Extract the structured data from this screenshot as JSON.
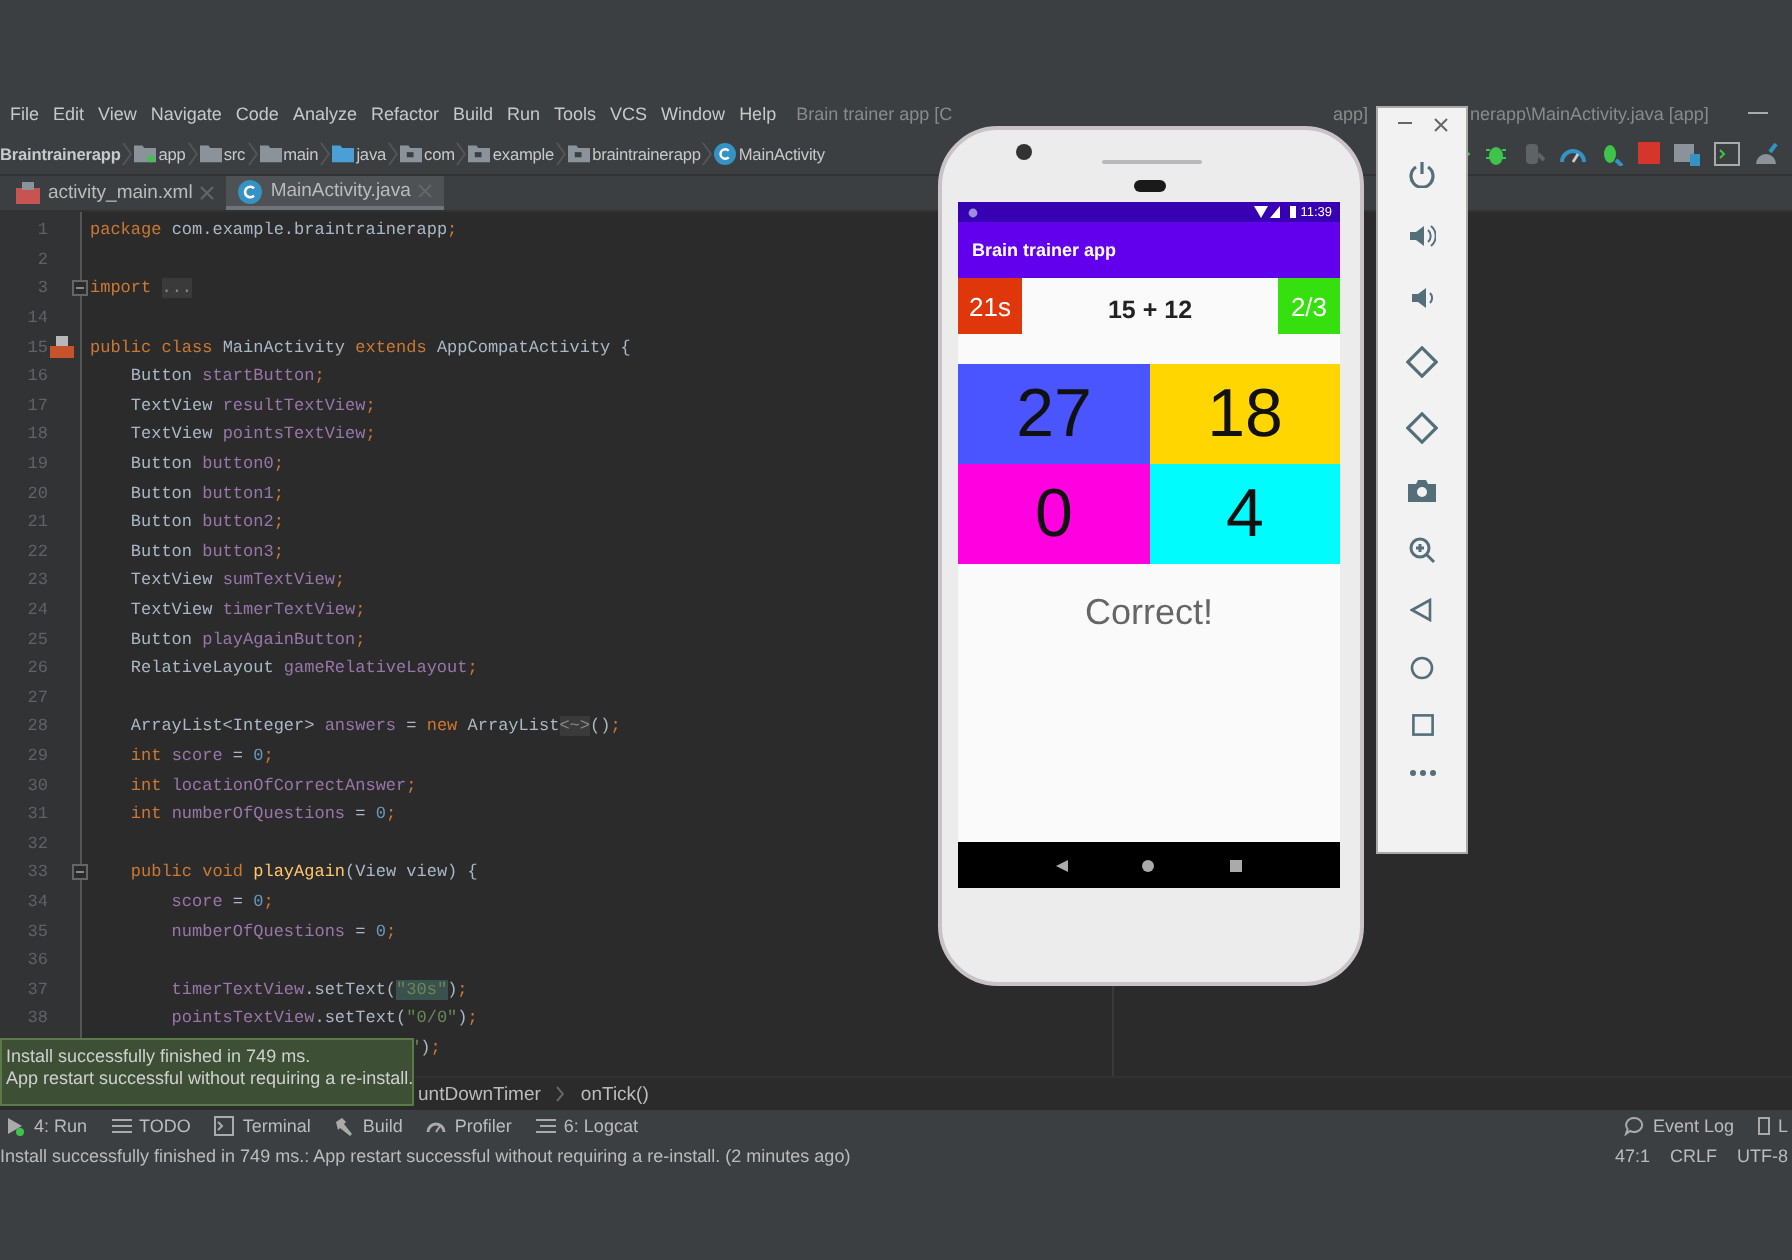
{
  "menu": {
    "items": [
      "File",
      "Edit",
      "View",
      "Navigate",
      "Code",
      "Analyze",
      "Refactor",
      "Build",
      "Run",
      "Tools",
      "VCS",
      "Window",
      "Help"
    ],
    "title_parts": [
      "Brain trainer app [C",
      "app]",
      "nerapp\\MainActivity.java [app]"
    ]
  },
  "breadcrumb": [
    {
      "label": "Braintrainerapp",
      "kind": "project"
    },
    {
      "label": "app",
      "kind": "module"
    },
    {
      "label": "src",
      "kind": "folder"
    },
    {
      "label": "main",
      "kind": "folder"
    },
    {
      "label": "java",
      "kind": "source"
    },
    {
      "label": "com",
      "kind": "package"
    },
    {
      "label": "example",
      "kind": "package"
    },
    {
      "label": "braintrainerapp",
      "kind": "package"
    },
    {
      "label": "MainActivity",
      "kind": "class"
    }
  ],
  "tabs": [
    {
      "label": "activity_main.xml",
      "kind": "layout",
      "selected": false
    },
    {
      "label": "MainActivity.java",
      "kind": "class",
      "selected": true
    }
  ],
  "editor": {
    "lines": [
      {
        "number": "1",
        "tokens": [
          {
            "kind": "k",
            "text": "package"
          },
          {
            "kind": "p",
            "text": " com.example.braintrainerapp"
          },
          {
            "kind": "k",
            "text": ";"
          }
        ]
      },
      {
        "number": "2"
      },
      {
        "number": "3",
        "kind": "fold",
        "tokens": [
          {
            "kind": "k",
            "text": "import "
          },
          {
            "kind": "g",
            "text": "..."
          }
        ]
      },
      {
        "number": "14"
      },
      {
        "number": "15",
        "kind": "class",
        "tokens": [
          {
            "kind": "k",
            "text": "public class "
          },
          {
            "kind": "p",
            "text": "MainActivity "
          },
          {
            "kind": "k",
            "text": "extends "
          },
          {
            "kind": "p",
            "text": "AppCompatActivity {"
          }
        ]
      },
      {
        "number": "16",
        "tokens": [
          {
            "kind": "p",
            "text": "    Button "
          },
          {
            "kind": "f",
            "text": "startButton"
          },
          {
            "kind": "k",
            "text": ";"
          }
        ]
      },
      {
        "number": "17",
        "tokens": [
          {
            "kind": "p",
            "text": "    TextView "
          },
          {
            "kind": "f",
            "text": "resultTextView"
          },
          {
            "kind": "k",
            "text": ";"
          }
        ]
      },
      {
        "number": "18",
        "tokens": [
          {
            "kind": "p",
            "text": "    TextView "
          },
          {
            "kind": "f",
            "text": "pointsTextView"
          },
          {
            "kind": "k",
            "text": ";"
          }
        ]
      },
      {
        "number": "19",
        "tokens": [
          {
            "kind": "p",
            "text": "    Button "
          },
          {
            "kind": "f",
            "text": "button0"
          },
          {
            "kind": "k",
            "text": ";"
          }
        ]
      },
      {
        "number": "20",
        "tokens": [
          {
            "kind": "p",
            "text": "    Button "
          },
          {
            "kind": "f",
            "text": "button1"
          },
          {
            "kind": "k",
            "text": ";"
          }
        ]
      },
      {
        "number": "21",
        "tokens": [
          {
            "kind": "p",
            "text": "    Button "
          },
          {
            "kind": "f",
            "text": "button2"
          },
          {
            "kind": "k",
            "text": ";"
          }
        ]
      },
      {
        "number": "22",
        "tokens": [
          {
            "kind": "p",
            "text": "    Button "
          },
          {
            "kind": "f",
            "text": "button3"
          },
          {
            "kind": "k",
            "text": ";"
          }
        ]
      },
      {
        "number": "23",
        "tokens": [
          {
            "kind": "p",
            "text": "    TextView "
          },
          {
            "kind": "f",
            "text": "sumTextView"
          },
          {
            "kind": "k",
            "text": ";"
          }
        ]
      },
      {
        "number": "24",
        "tokens": [
          {
            "kind": "p",
            "text": "    TextView "
          },
          {
            "kind": "f",
            "text": "timerTextView"
          },
          {
            "kind": "k",
            "text": ";"
          }
        ]
      },
      {
        "number": "25",
        "tokens": [
          {
            "kind": "p",
            "text": "    Button "
          },
          {
            "kind": "f",
            "text": "playAgainButton"
          },
          {
            "kind": "k",
            "text": ";"
          }
        ]
      },
      {
        "number": "26",
        "tokens": [
          {
            "kind": "p",
            "text": "    RelativeLayout "
          },
          {
            "kind": "f",
            "text": "gameRelativeLayout"
          },
          {
            "kind": "k",
            "text": ";"
          }
        ]
      },
      {
        "number": "27"
      },
      {
        "number": "28",
        "tokens": [
          {
            "kind": "p",
            "text": "    ArrayList<Integer> "
          },
          {
            "kind": "f",
            "text": "answers"
          },
          {
            "kind": "p",
            "text": " = "
          },
          {
            "kind": "k",
            "text": "new "
          },
          {
            "kind": "p",
            "text": "ArrayList"
          },
          {
            "kind": "g",
            "text": "<~>"
          },
          {
            "kind": "p",
            "text": "()"
          },
          {
            "kind": "k",
            "text": ";"
          }
        ]
      },
      {
        "number": "29",
        "tokens": [
          {
            "kind": "k",
            "text": "    int "
          },
          {
            "kind": "f",
            "text": "score"
          },
          {
            "kind": "p",
            "text": " = "
          },
          {
            "kind": "n",
            "text": "0"
          },
          {
            "kind": "k",
            "text": ";"
          }
        ]
      },
      {
        "number": "30",
        "tokens": [
          {
            "kind": "k",
            "text": "    int "
          },
          {
            "kind": "f",
            "text": "locationOfCorrectAnswer"
          },
          {
            "kind": "k",
            "text": ";"
          }
        ]
      },
      {
        "number": "31",
        "tokens": [
          {
            "kind": "k",
            "text": "    int "
          },
          {
            "kind": "f",
            "text": "numberOfQuestions"
          },
          {
            "kind": "p",
            "text": " = "
          },
          {
            "kind": "n",
            "text": "0"
          },
          {
            "kind": "k",
            "text": ";"
          }
        ]
      },
      {
        "number": "32"
      },
      {
        "number": "33",
        "kind": "fold",
        "tokens": [
          {
            "kind": "k",
            "text": "    public void "
          },
          {
            "kind": "m",
            "text": "playAgain"
          },
          {
            "kind": "p",
            "text": "(View view) {"
          }
        ]
      },
      {
        "number": "34",
        "tokens": [
          {
            "kind": "f",
            "text": "        score"
          },
          {
            "kind": "p",
            "text": " = "
          },
          {
            "kind": "n",
            "text": "0"
          },
          {
            "kind": "k",
            "text": ";"
          }
        ]
      },
      {
        "number": "35",
        "tokens": [
          {
            "kind": "f",
            "text": "        numberOfQuestions"
          },
          {
            "kind": "p",
            "text": " = "
          },
          {
            "kind": "n",
            "text": "0"
          },
          {
            "kind": "k",
            "text": ";"
          }
        ]
      },
      {
        "number": "36"
      },
      {
        "number": "37",
        "tokens": [
          {
            "kind": "f",
            "text": "        timerTextView"
          },
          {
            "kind": "p",
            "text": ".setText("
          },
          {
            "kind": "h",
            "text": "\"30s\""
          },
          {
            "kind": "p",
            "text": ")"
          },
          {
            "kind": "k",
            "text": ";"
          }
        ]
      },
      {
        "number": "38",
        "tokens": [
          {
            "kind": "f",
            "text": "        pointsTextView"
          },
          {
            "kind": "p",
            "text": ".setText("
          },
          {
            "kind": "s",
            "text": "\"0/0\""
          },
          {
            "kind": "p",
            "text": ")"
          },
          {
            "kind": "k",
            "text": ";"
          }
        ]
      },
      {
        "tokens": [
          {
            "kind": "s",
            "text": "\""
          },
          {
            "kind": "p",
            "text": ")"
          },
          {
            "kind": "k",
            "text": ";"
          }
        ]
      }
    ],
    "crumb": [
      "untDownTimer",
      "onTick()"
    ]
  },
  "notification": [
    "Install successfully finished in 749 ms.",
    "App restart successful without requiring a re-install."
  ],
  "tool_windows": [
    {
      "label": "4: Run",
      "kind": "run"
    },
    {
      "label": "TODO",
      "kind": "todo"
    },
    {
      "label": "Terminal",
      "kind": "terminal"
    },
    {
      "label": "Build",
      "kind": "build"
    },
    {
      "label": "Profiler",
      "kind": "profiler"
    },
    {
      "label": "6: Logcat",
      "kind": "logcat"
    }
  ],
  "tool_windows_right": [
    {
      "label": "Event Log",
      "kind": "event"
    },
    {
      "label": "L",
      "kind": "layout"
    }
  ],
  "status_bar": {
    "message": "Install successfully finished in 749 ms.: App restart successful without requiring a re-install. (2 minutes ago)",
    "position": "47:1",
    "line_separator": "CRLF",
    "encoding": "UTF-8"
  },
  "phone": {
    "status_time": "11:39",
    "app_title": "Brain trainer app",
    "timer": "21s",
    "sum": "15 + 12",
    "score": "2/3",
    "answers": [
      {
        "text": "27",
        "color": "#4a55ff"
      },
      {
        "text": "18",
        "color": "#ffd600"
      },
      {
        "text": "0",
        "color": "#ff00e0"
      },
      {
        "text": "4",
        "color": "#00fcfc"
      }
    ],
    "result": "Correct!"
  }
}
